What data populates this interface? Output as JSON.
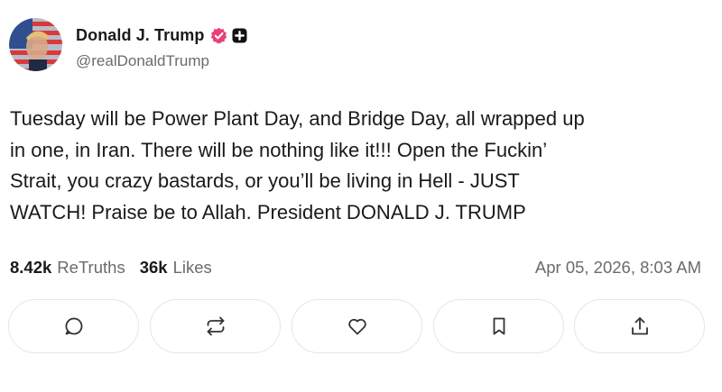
{
  "author": {
    "display_name": "Donald J. Trump",
    "handle": "@realDonaldTrump",
    "verified_color": "#e8407a"
  },
  "post": {
    "text": "Tuesday will be Power Plant Day, and Bridge Day, all wrapped up\nin one, in Iran. There will be nothing like it!!! Open the Fuckin’\nStrait, you crazy bastards, or you’ll be living in Hell - JUST\nWATCH! Praise be to Allah. President DONALD J. TRUMP"
  },
  "stats": {
    "retruths_count": "8.42k",
    "retruths_label": "ReTruths",
    "likes_count": "36k",
    "likes_label": "Likes",
    "timestamp": "Apr 05, 2026, 8:03 AM"
  },
  "actions": [
    {
      "icon": "comment-icon"
    },
    {
      "icon": "retruth-icon"
    },
    {
      "icon": "heart-icon"
    },
    {
      "icon": "bookmark-icon"
    },
    {
      "icon": "share-icon"
    }
  ]
}
